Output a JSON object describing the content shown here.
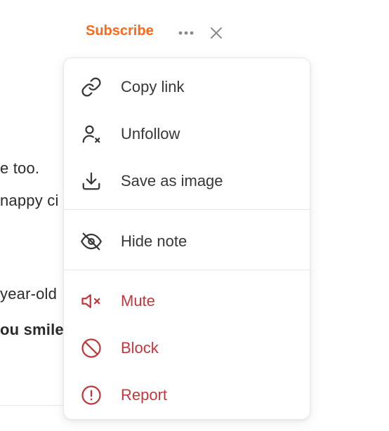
{
  "header": {
    "subscribe_label": "Subscribe",
    "more_icon": "ellipsis-icon",
    "close_icon": "close-icon",
    "accent_color": "#ff6719"
  },
  "background_note": {
    "lines": [
      "e too.",
      "nappy ci",
      "year-old",
      "ou smile"
    ]
  },
  "menu": {
    "items": [
      {
        "label": "Copy link",
        "icon": "link-icon"
      },
      {
        "label": "Unfollow",
        "icon": "unfollow-user-icon"
      },
      {
        "label": "Save as image",
        "icon": "download-icon"
      },
      {
        "label": "Hide note",
        "icon": "eye-off-icon"
      },
      {
        "label": "Mute",
        "icon": "speaker-mute-icon"
      },
      {
        "label": "Block",
        "icon": "block-icon"
      },
      {
        "label": "Report",
        "icon": "alert-circle-icon"
      }
    ],
    "danger_color": "#c1383c"
  }
}
